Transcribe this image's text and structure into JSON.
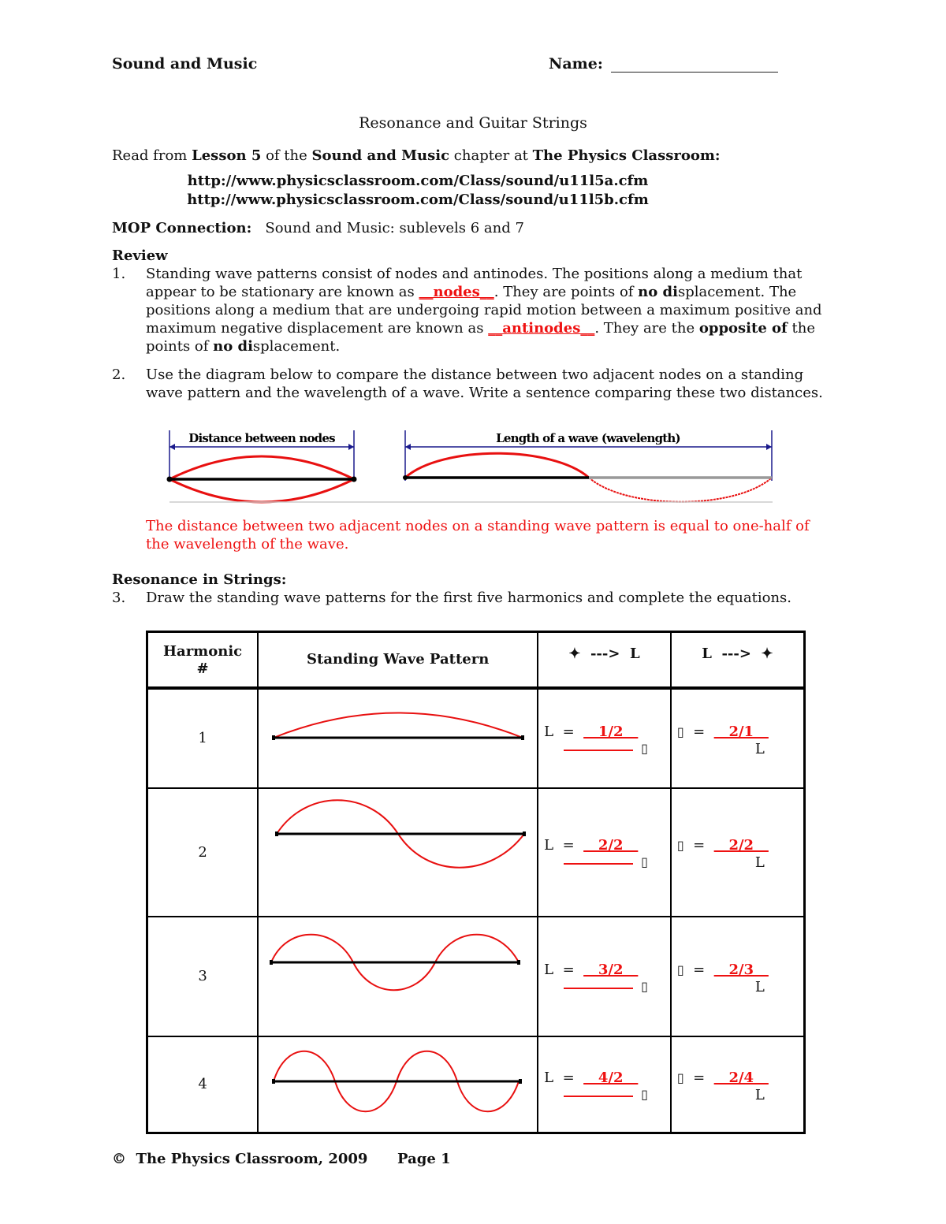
{
  "header": {
    "course": "Sound and Music",
    "name_label": "Name:"
  },
  "title": "Resonance and Guitar Strings",
  "reading": {
    "prefix": "Read from ",
    "lesson": "Lesson 5",
    "mid1": " of the ",
    "chapter": "Sound and Music",
    "mid2": " chapter at ",
    "site": "The Physics Classroom:",
    "links": [
      "http://www.physicsclassroom.com/Class/sound/u11l5a.cfm",
      "http://www.physicsclassroom.com/Class/sound/u11l5b.cfm"
    ]
  },
  "mop": {
    "label": "MOP Connection:",
    "value": "Sound and Music:  sublevels 6 and 7"
  },
  "review": {
    "heading": "Review",
    "q1": {
      "num": "1.",
      "t1": "Standing wave patterns consist of nodes and antinodes.  The positions along a medium that appear to be stationary are known as ",
      "a1": "__nodes__",
      "t2": ".  They are points of ",
      "b1": "no di",
      "t3": "splacement. The positions along a medium that are undergoing rapid motion between a maximum positive and maximum negative displacement are known as ",
      "a2": "__antinodes__",
      "t4": ".  They are the ",
      "b2": "opposite of",
      "t5": " the points of ",
      "b3": "no di",
      "t6": "splacement."
    },
    "q2": {
      "num": "2.",
      "text": "Use the diagram below to compare the distance between two adjacent nodes on a standing wave pattern and the wavelength of a wave.  Write a sentence comparing these two distances.",
      "diagram": {
        "label_left": "Distance between nodes",
        "label_right": "Length of a wave (wavelength)"
      },
      "answer": "The distance between two adjacent nodes on a standing wave pattern is equal to one-half of the wavelength of the wave."
    }
  },
  "resonance": {
    "heading": "Resonance in Strings:",
    "q3": {
      "num": "3.",
      "text": "Draw the standing wave patterns for the first five harmonics and complete the equations."
    },
    "table": {
      "headers": [
        "Harmonic #",
        "Standing Wave Pattern",
        "✦  --->  L",
        "L  --->  ✦"
      ],
      "rows": [
        {
          "harmonic": "1",
          "L_coef": "1/2",
          "lambda_coef": "2/1"
        },
        {
          "harmonic": "2",
          "L_coef": "2/2",
          "lambda_coef": "2/2"
        },
        {
          "harmonic": "3",
          "L_coef": "3/2",
          "lambda_coef": "2/3"
        },
        {
          "harmonic": "4",
          "L_coef": "4/2",
          "lambda_coef": "2/4"
        }
      ],
      "eq_L": "L",
      "eq_equals": "=",
      "lambda_symbol": "▯"
    }
  },
  "footer": {
    "copyright": "©",
    "org": "The Physics Classroom, 2009",
    "page": "Page 1"
  },
  "colors": {
    "answer": "#ee1111",
    "ink": "#111111"
  }
}
